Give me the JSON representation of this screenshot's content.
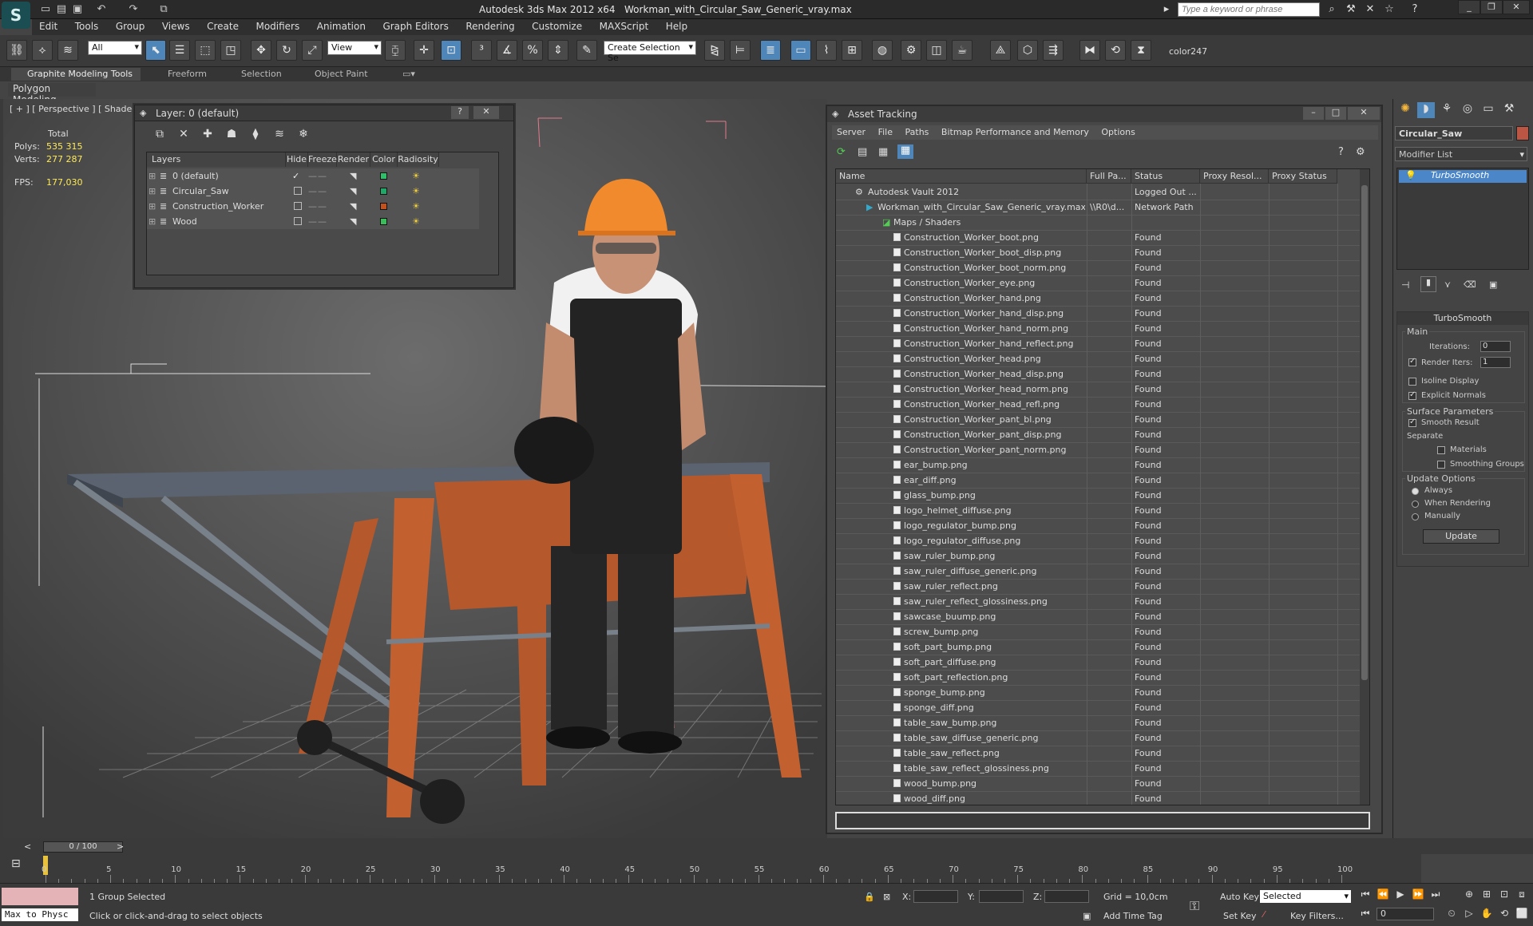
{
  "app": {
    "title": "Autodesk 3ds Max  2012 x64",
    "file": "Workman_with_Circular_Saw_Generic_vray.max",
    "search_placeholder": "Type a keyword or phrase"
  },
  "menu": [
    "Edit",
    "Tools",
    "Group",
    "Views",
    "Create",
    "Modifiers",
    "Animation",
    "Graph Editors",
    "Rendering",
    "Customize",
    "MAXScript",
    "Help"
  ],
  "toolbar": {
    "selection_filter": "All",
    "ref_coord": "View",
    "named_selection": "Create Selection Se",
    "color_label": "color247"
  },
  "ribbon": {
    "tabs": [
      "Graphite Modeling Tools",
      "Freeform",
      "Selection",
      "Object Paint"
    ],
    "panel": "Polygon Modeling"
  },
  "viewport": {
    "label": "[ + ] [ Perspective ] [ Shaded ]",
    "total_label": "Total",
    "polys_label": "Polys:",
    "polys": "535 315",
    "verts_label": "Verts:",
    "verts": "277 287",
    "fps_label": "FPS:",
    "fps": "177,030"
  },
  "layer_window": {
    "title": "Layer: 0 (default)",
    "help": "?",
    "close": "✕",
    "columns": [
      "Layers",
      "Hide",
      "Freeze",
      "Render",
      "Color",
      "Radiosity"
    ],
    "rows": [
      {
        "name": "0 (default)",
        "color": "#2fbf6b"
      },
      {
        "name": "Circular_Saw",
        "color": "#1fa868"
      },
      {
        "name": "Construction_Worker",
        "color": "#c2511e"
      },
      {
        "name": "Wood",
        "color": "#3bbd5c"
      }
    ]
  },
  "asset_tracking": {
    "title": "Asset Tracking",
    "menu": [
      "Server",
      "File",
      "Paths",
      "Bitmap Performance and Memory",
      "Options"
    ],
    "columns": [
      "Name",
      "Full Pa...",
      "Status",
      "Proxy Resol...",
      "Proxy Status"
    ],
    "vault": {
      "name": "Autodesk Vault 2012",
      "status": "Logged Out ..."
    },
    "file": {
      "name": "Workman_with_Circular_Saw_Generic_vray.max",
      "path": "\\\\R0\\d...",
      "status": "Network Path"
    },
    "maps_group": "Maps / Shaders",
    "found_label": "Found",
    "maps": [
      "Construction_Worker_boot.png",
      "Construction_Worker_boot_disp.png",
      "Construction_Worker_boot_norm.png",
      "Construction_Worker_eye.png",
      "Construction_Worker_hand.png",
      "Construction_Worker_hand_disp.png",
      "Construction_Worker_hand_norm.png",
      "Construction_Worker_hand_reflect.png",
      "Construction_Worker_head.png",
      "Construction_Worker_head_disp.png",
      "Construction_Worker_head_norm.png",
      "Construction_Worker_head_refl.png",
      "Construction_Worker_pant_bl.png",
      "Construction_Worker_pant_disp.png",
      "Construction_Worker_pant_norm.png",
      "ear_bump.png",
      "ear_diff.png",
      "glass_bump.png",
      "logo_helmet_diffuse.png",
      "logo_regulator_bump.png",
      "logo_regulator_diffuse.png",
      "saw_ruler_bump.png",
      "saw_ruler_diffuse_generic.png",
      "saw_ruler_reflect.png",
      "saw_ruler_reflect_glossiness.png",
      "sawcase_buump.png",
      "screw_bump.png",
      "soft_part_bump.png",
      "soft_part_diffuse.png",
      "soft_part_reflection.png",
      "sponge_bump.png",
      "sponge_diff.png",
      "table_saw_bump.png",
      "table_saw_diffuse_generic.png",
      "table_saw_reflect.png",
      "table_saw_reflect_glossiness.png",
      "wood_bump.png",
      "wood_diff.png"
    ]
  },
  "command_panel": {
    "object_name": "Circular_Saw",
    "modifier_list": "Modifier List",
    "stack_item": "TurboSmooth",
    "rollout_title": "TurboSmooth",
    "main_label": "Main",
    "iterations_label": "Iterations:",
    "iterations": "0",
    "render_iters_label": "Render Iters:",
    "render_iters": "1",
    "isoline": "Isoline Display",
    "explicit_normals": "Explicit Normals",
    "surface_params": "Surface Parameters",
    "smooth_result": "Smooth Result",
    "separate": "Separate",
    "materials": "Materials",
    "smoothing_groups": "Smoothing Groups",
    "update_options": "Update Options",
    "always": "Always",
    "when_rendering": "When Rendering",
    "manually": "Manually",
    "update": "Update"
  },
  "timeline": {
    "frame": "0 / 100",
    "labels": [
      "0",
      "5",
      "10",
      "15",
      "20",
      "25",
      "30",
      "35",
      "40",
      "45",
      "50",
      "55",
      "60",
      "65",
      "70",
      "75",
      "80",
      "85",
      "90",
      "95",
      "100"
    ]
  },
  "status": {
    "maxscript": "Max to Physc",
    "selected": "1 Group Selected",
    "prompt": "Click or click-and-drag to select objects",
    "x_label": "X:",
    "y_label": "Y:",
    "z_label": "Z:",
    "grid": "Grid = 10,0cm",
    "add_time_tag": "Add Time Tag",
    "auto_key": "Auto Key",
    "set_key": "Set Key",
    "key_mode": "Selected",
    "key_filters": "Key Filters...",
    "current_frame": "0"
  }
}
